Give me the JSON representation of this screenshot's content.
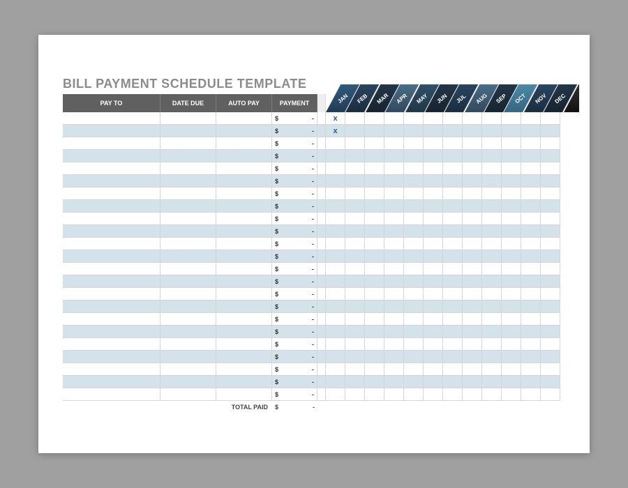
{
  "title": "BILL PAYMENT SCHEDULE TEMPLATE",
  "headers": {
    "payto": "PAY TO",
    "datedue": "DATE DUE",
    "autopay": "AUTO PAY",
    "payment": "PAYMENT"
  },
  "months": [
    "JAN",
    "FEB",
    "MAR",
    "APR",
    "MAY",
    "JUN",
    "JUL",
    "AUG",
    "SEP",
    "OCT",
    "NOV",
    "DEC"
  ],
  "payment_currency": "$",
  "payment_empty_value": "-",
  "rows": [
    {
      "payto": "",
      "datedue": "",
      "autopay": "",
      "payment": "-",
      "marks": [
        "x",
        "",
        "",
        "",
        "",
        "",
        "",
        "",
        "",
        "",
        "",
        ""
      ]
    },
    {
      "payto": "",
      "datedue": "",
      "autopay": "",
      "payment": "-",
      "marks": [
        "x",
        "",
        "",
        "",
        "",
        "",
        "",
        "",
        "",
        "",
        "",
        ""
      ]
    },
    {
      "payto": "",
      "datedue": "",
      "autopay": "",
      "payment": "-",
      "marks": [
        "",
        "",
        "",
        "",
        "",
        "",
        "",
        "",
        "",
        "",
        "",
        ""
      ]
    },
    {
      "payto": "",
      "datedue": "",
      "autopay": "",
      "payment": "-",
      "marks": [
        "",
        "",
        "",
        "",
        "",
        "",
        "",
        "",
        "",
        "",
        "",
        ""
      ]
    },
    {
      "payto": "",
      "datedue": "",
      "autopay": "",
      "payment": "-",
      "marks": [
        "",
        "",
        "",
        "",
        "",
        "",
        "",
        "",
        "",
        "",
        "",
        ""
      ]
    },
    {
      "payto": "",
      "datedue": "",
      "autopay": "",
      "payment": "-",
      "marks": [
        "",
        "",
        "",
        "",
        "",
        "",
        "",
        "",
        "",
        "",
        "",
        ""
      ]
    },
    {
      "payto": "",
      "datedue": "",
      "autopay": "",
      "payment": "-",
      "marks": [
        "",
        "",
        "",
        "",
        "",
        "",
        "",
        "",
        "",
        "",
        "",
        ""
      ]
    },
    {
      "payto": "",
      "datedue": "",
      "autopay": "",
      "payment": "-",
      "marks": [
        "",
        "",
        "",
        "",
        "",
        "",
        "",
        "",
        "",
        "",
        "",
        ""
      ]
    },
    {
      "payto": "",
      "datedue": "",
      "autopay": "",
      "payment": "-",
      "marks": [
        "",
        "",
        "",
        "",
        "",
        "",
        "",
        "",
        "",
        "",
        "",
        ""
      ]
    },
    {
      "payto": "",
      "datedue": "",
      "autopay": "",
      "payment": "-",
      "marks": [
        "",
        "",
        "",
        "",
        "",
        "",
        "",
        "",
        "",
        "",
        "",
        ""
      ]
    },
    {
      "payto": "",
      "datedue": "",
      "autopay": "",
      "payment": "-",
      "marks": [
        "",
        "",
        "",
        "",
        "",
        "",
        "",
        "",
        "",
        "",
        "",
        ""
      ]
    },
    {
      "payto": "",
      "datedue": "",
      "autopay": "",
      "payment": "-",
      "marks": [
        "",
        "",
        "",
        "",
        "",
        "",
        "",
        "",
        "",
        "",
        "",
        ""
      ]
    },
    {
      "payto": "",
      "datedue": "",
      "autopay": "",
      "payment": "-",
      "marks": [
        "",
        "",
        "",
        "",
        "",
        "",
        "",
        "",
        "",
        "",
        "",
        ""
      ]
    },
    {
      "payto": "",
      "datedue": "",
      "autopay": "",
      "payment": "-",
      "marks": [
        "",
        "",
        "",
        "",
        "",
        "",
        "",
        "",
        "",
        "",
        "",
        ""
      ]
    },
    {
      "payto": "",
      "datedue": "",
      "autopay": "",
      "payment": "-",
      "marks": [
        "",
        "",
        "",
        "",
        "",
        "",
        "",
        "",
        "",
        "",
        "",
        ""
      ]
    },
    {
      "payto": "",
      "datedue": "",
      "autopay": "",
      "payment": "-",
      "marks": [
        "",
        "",
        "",
        "",
        "",
        "",
        "",
        "",
        "",
        "",
        "",
        ""
      ]
    },
    {
      "payto": "",
      "datedue": "",
      "autopay": "",
      "payment": "-",
      "marks": [
        "",
        "",
        "",
        "",
        "",
        "",
        "",
        "",
        "",
        "",
        "",
        ""
      ]
    },
    {
      "payto": "",
      "datedue": "",
      "autopay": "",
      "payment": "-",
      "marks": [
        "",
        "",
        "",
        "",
        "",
        "",
        "",
        "",
        "",
        "",
        "",
        ""
      ]
    },
    {
      "payto": "",
      "datedue": "",
      "autopay": "",
      "payment": "-",
      "marks": [
        "",
        "",
        "",
        "",
        "",
        "",
        "",
        "",
        "",
        "",
        "",
        ""
      ]
    },
    {
      "payto": "",
      "datedue": "",
      "autopay": "",
      "payment": "-",
      "marks": [
        "",
        "",
        "",
        "",
        "",
        "",
        "",
        "",
        "",
        "",
        "",
        ""
      ]
    },
    {
      "payto": "",
      "datedue": "",
      "autopay": "",
      "payment": "-",
      "marks": [
        "",
        "",
        "",
        "",
        "",
        "",
        "",
        "",
        "",
        "",
        "",
        ""
      ]
    },
    {
      "payto": "",
      "datedue": "",
      "autopay": "",
      "payment": "-",
      "marks": [
        "",
        "",
        "",
        "",
        "",
        "",
        "",
        "",
        "",
        "",
        "",
        ""
      ]
    },
    {
      "payto": "",
      "datedue": "",
      "autopay": "",
      "payment": "-",
      "marks": [
        "",
        "",
        "",
        "",
        "",
        "",
        "",
        "",
        "",
        "",
        "",
        ""
      ]
    }
  ],
  "footer": {
    "label": "TOTAL PAID",
    "currency": "$",
    "value": "-"
  },
  "colors": {
    "row_alt": "#d4e2ea",
    "header_bg": "#606060",
    "title": "#8b8b8b",
    "mark": "#2a5b8a"
  }
}
